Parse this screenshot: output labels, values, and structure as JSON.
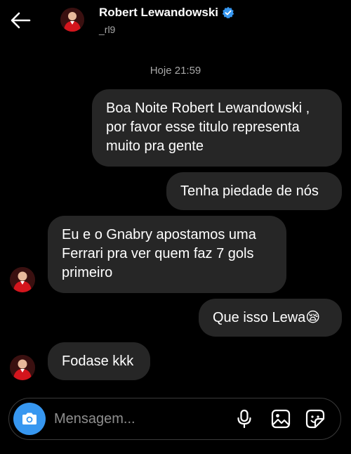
{
  "header": {
    "contact_name": "Robert Lewandowski",
    "handle": "_rl9",
    "icons": [
      "back-arrow-icon",
      "avatar",
      "verified-badge-icon"
    ]
  },
  "conversation": {
    "timestamp": "Hoje 21:59",
    "messages": [
      {
        "sender": "me",
        "text": "Boa Noite Robert Lewandowski ,\npor favor esse titulo representa\nmuito pra gente"
      },
      {
        "sender": "me",
        "text": "Tenha piedade de nós"
      },
      {
        "sender": "contact",
        "text": "Eu e o Gnabry apostamos uma\nFerrari pra ver quem faz 7 gols\nprimeiro"
      },
      {
        "sender": "me",
        "text": "Que isso Lewa😪"
      },
      {
        "sender": "contact",
        "text": "Fodase kkk"
      }
    ]
  },
  "composer": {
    "placeholder": "Mensagem...",
    "icons": [
      "camera-icon",
      "microphone-icon",
      "image-icon",
      "sticker-icon"
    ]
  },
  "colors": {
    "background": "#000000",
    "bubble": "#262626",
    "accent": "#3797f0",
    "muted_text": "#a8a8a8"
  }
}
